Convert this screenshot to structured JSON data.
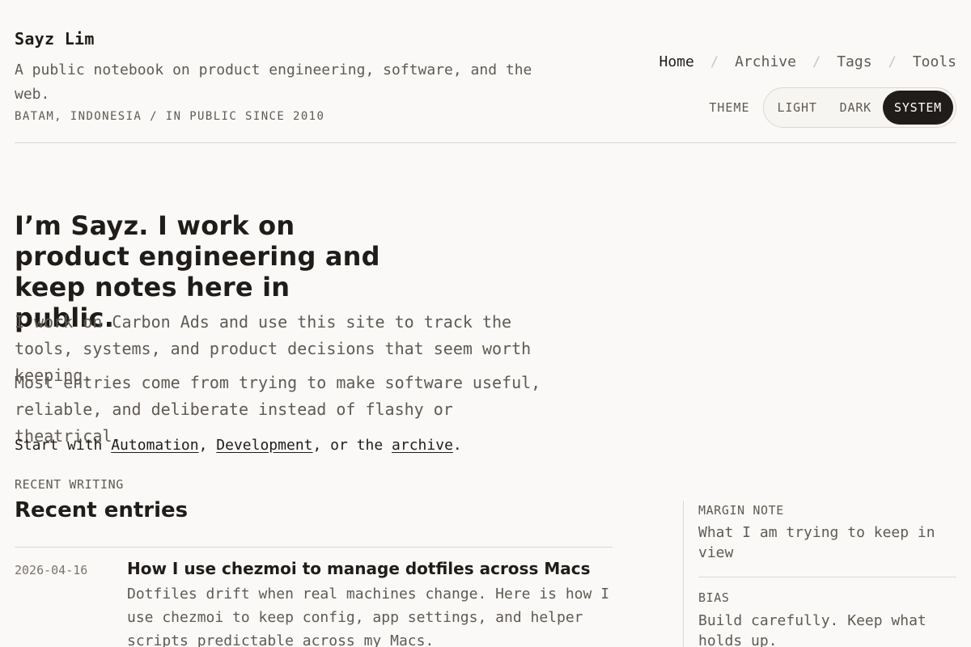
{
  "site": {
    "name": "Sayz Lim",
    "tagline": "A public notebook on product engineering, software, and the web.",
    "location": "BATAM, INDONESIA / IN PUBLIC SINCE 2010"
  },
  "nav": {
    "items": [
      {
        "label": "Home",
        "active": true
      },
      {
        "label": "Archive",
        "active": false
      },
      {
        "label": "Tags",
        "active": false
      },
      {
        "label": "Tools",
        "active": false
      }
    ],
    "separator": "/"
  },
  "theme": {
    "label": "THEME",
    "options": [
      "LIGHT",
      "DARK",
      "SYSTEM"
    ],
    "selected": "SYSTEM"
  },
  "hero": {
    "title": "I’m Sayz. I work on product engineering and keep notes here in public.",
    "intro_1": "I work on Carbon Ads and use this site to track the tools, systems, and product decisions that seem worth keeping.",
    "intro_2": "Most entries come from trying to make software useful, reliable, and deliberate instead of flashy or theatrical.",
    "start": {
      "prefix": "Start with",
      "link_1": "Automation",
      "comma": ",",
      "link_2": "Development",
      "middle": ", or the",
      "link_3": "archive",
      "suffix": "."
    }
  },
  "recent": {
    "kicker": "RECENT WRITING",
    "title": "Recent entries",
    "entries": [
      {
        "date": "2026-04-16",
        "title": "How I use chezmoi to manage dotfiles across Macs",
        "summary": "Dotfiles drift when real machines change. Here is how I use chezmoi to keep config, app settings, and helper scripts predictable across my Macs."
      }
    ]
  },
  "aside": {
    "margin_kicker": "MARGIN NOTE",
    "margin_text": "What I am trying to keep in view",
    "bias_kicker": "BIAS",
    "bias_text": "Build carefully. Keep what holds up."
  }
}
